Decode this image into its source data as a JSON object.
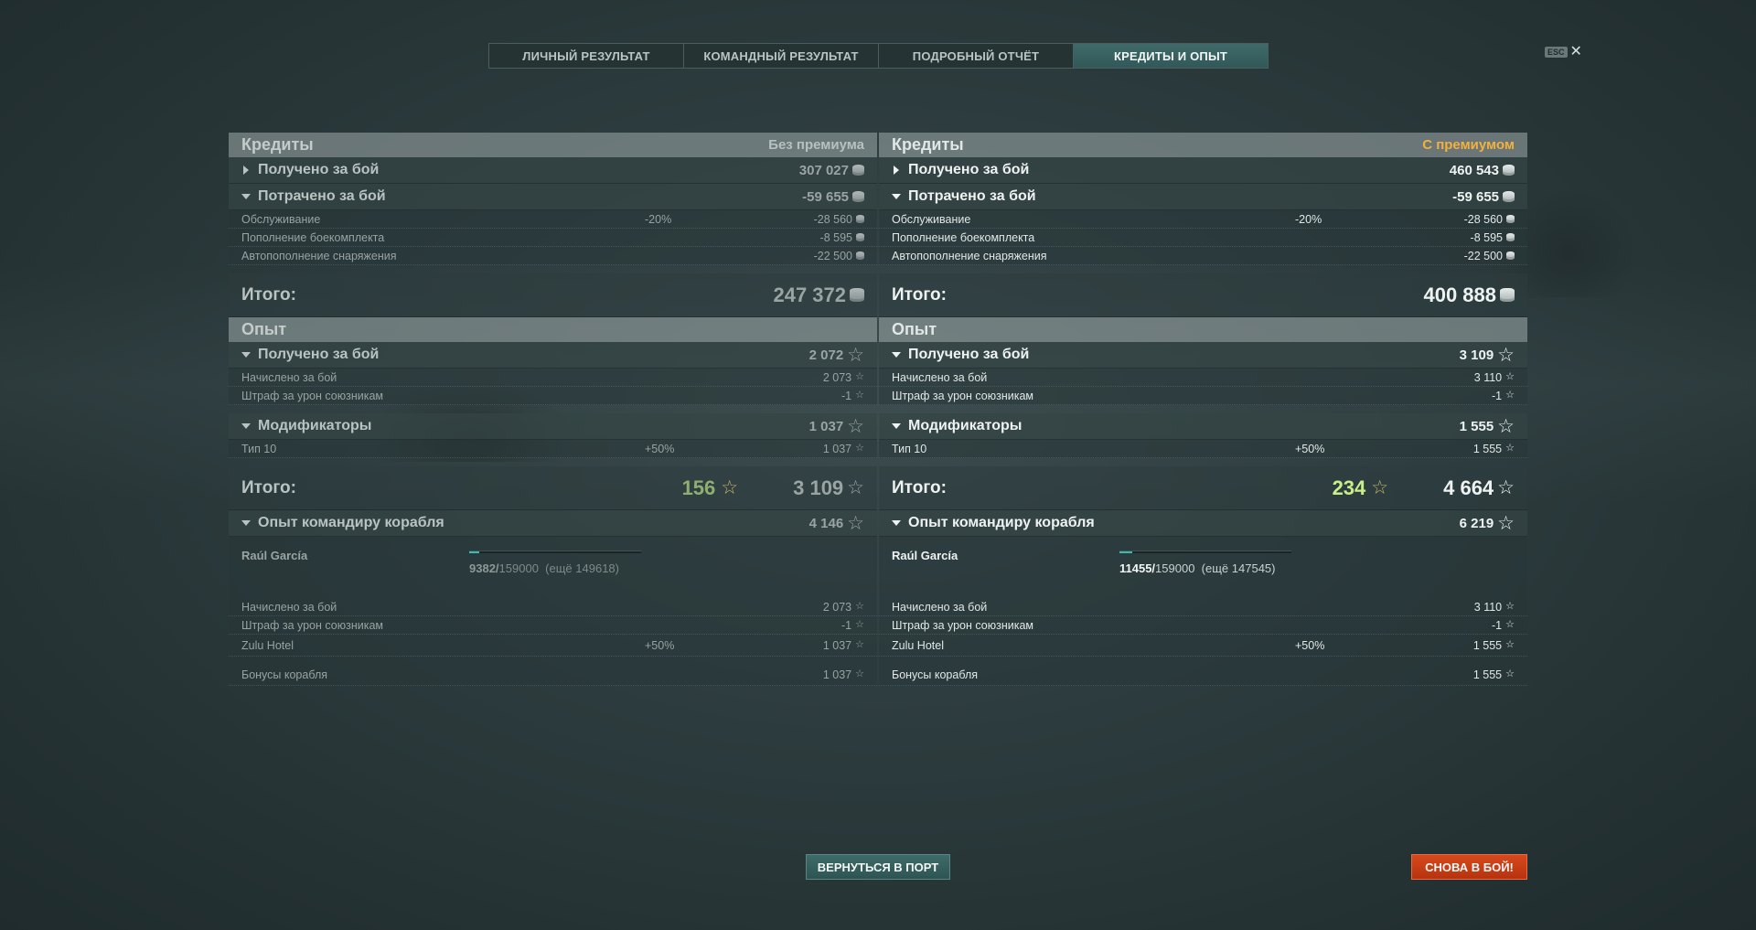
{
  "tabs": [
    "ЛИЧНЫЙ РЕЗУЛЬТАТ",
    "КОМАНДНЫЙ РЕЗУЛЬТАТ",
    "ПОДРОБНЫЙ ОТЧЁТ",
    "КРЕДИТЫ И ОПЫТ"
  ],
  "active_tab": 3,
  "esc_label": "ESC",
  "close_symbol": "✕",
  "left": {
    "credits_title": "Кредиты",
    "credits_note": "Без премиума",
    "earned_label": "Получено за бой",
    "earned_value": "307 027",
    "spent_label": "Потрачено за бой",
    "spent_value": "-59 655",
    "service_label": "Обслуживание",
    "service_pct": "-20%",
    "service_value": "-28 560",
    "ammo_label": "Пополнение боекомплекта",
    "ammo_value": "-8 595",
    "consumables_label": "Автопополнение снаряжения",
    "consumables_value": "-22 500",
    "credits_total_label": "Итого:",
    "credits_total_value": "247 372",
    "xp_title": "Опыт",
    "xp_earned_label": "Получено за бой",
    "xp_earned_value": "2 072",
    "xp_accrued_label": "Начислено за бой",
    "xp_accrued_value": "2 073",
    "xp_penalty_label": "Штраф за урон союзникам",
    "xp_penalty_value": "-1",
    "mods_label": "Модификаторы",
    "mods_value": "1 037",
    "tier_label": "Тип 10",
    "tier_pct": "+50%",
    "tier_value": "1 037",
    "xp_total_label": "Итого:",
    "xp_free": "156",
    "xp_total_value": "3 109",
    "cmdr_label": "Опыт командиру корабля",
    "cmdr_value": "4 146",
    "cmdr_name": "Raúl García",
    "cmdr_current": "9382/",
    "cmdr_max": "159000",
    "cmdr_remaining": "(ещё 149618)",
    "cmdr_progress": 0.059,
    "c_accrued_label": "Начислено за бой",
    "c_accrued_value": "2 073",
    "c_penalty_label": "Штраф за урон союзникам",
    "c_penalty_value": "-1",
    "c_flag_label": "Zulu Hotel",
    "c_flag_pct": "+50%",
    "c_flag_value": "1 037",
    "c_ship_label": "Бонусы корабля",
    "c_ship_value": "1 037"
  },
  "right": {
    "credits_title": "Кредиты",
    "credits_note": "С премиумом",
    "earned_label": "Получено за бой",
    "earned_value": "460 543",
    "spent_label": "Потрачено за бой",
    "spent_value": "-59 655",
    "service_label": "Обслуживание",
    "service_pct": "-20%",
    "service_value": "-28 560",
    "ammo_label": "Пополнение боекомплекта",
    "ammo_value": "-8 595",
    "consumables_label": "Автопополнение снаряжения",
    "consumables_value": "-22 500",
    "credits_total_label": "Итого:",
    "credits_total_value": "400 888",
    "xp_title": "Опыт",
    "xp_earned_label": "Получено за бой",
    "xp_earned_value": "3 109",
    "xp_accrued_label": "Начислено за бой",
    "xp_accrued_value": "3 110",
    "xp_penalty_label": "Штраф за урон союзникам",
    "xp_penalty_value": "-1",
    "mods_label": "Модификаторы",
    "mods_value": "1 555",
    "tier_label": "Тип 10",
    "tier_pct": "+50%",
    "tier_value": "1 555",
    "xp_total_label": "Итого:",
    "xp_free": "234",
    "xp_total_value": "4 664",
    "cmdr_label": "Опыт командиру корабля",
    "cmdr_value": "6 219",
    "cmdr_name": "Raúl García",
    "cmdr_current": "11455/",
    "cmdr_max": "159000",
    "cmdr_remaining": "(ещё 147545)",
    "cmdr_progress": 0.072,
    "c_accrued_label": "Начислено за бой",
    "c_accrued_value": "3 110",
    "c_penalty_label": "Штраф за урон союзникам",
    "c_penalty_value": "-1",
    "c_flag_label": "Zulu Hotel",
    "c_flag_pct": "+50%",
    "c_flag_value": "1 555",
    "c_ship_label": "Бонусы корабля",
    "c_ship_value": "1 555"
  },
  "buttons": {
    "to_port": "ВЕРНУТЬСЯ В ПОРТ",
    "battle_again": "СНОВА В БОЙ!"
  },
  "colors": {
    "accent_tab": "#3f6a6a",
    "premium_label": "#f2b13c",
    "free_xp": "#c8ef8a",
    "battle_button": "#d8481c",
    "progress_fill": "#3fb8b2"
  }
}
